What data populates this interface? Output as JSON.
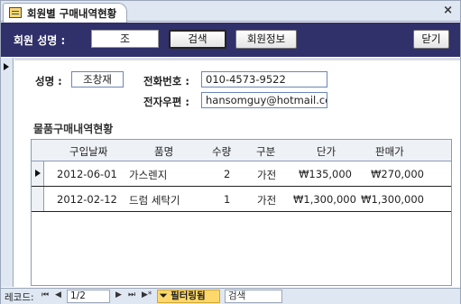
{
  "tab": {
    "title": "회원별 구매내역현황",
    "close": "×"
  },
  "header": {
    "member_name_label": "회원 성명 :",
    "member_name_value": "조",
    "search_button": "검색",
    "member_info_button": "회원정보",
    "close_button": "닫기"
  },
  "member": {
    "name_label": "성명 :",
    "name_value": "조창재",
    "phone_label": "전화번호 :",
    "phone_value": "010-4573-9522",
    "email_label": "전자우편 :",
    "email_value": "hansomguy@hotmail.co.kr"
  },
  "purchases": {
    "title": "물품구매내역현황",
    "columns": [
      "구입날짜",
      "품명",
      "수량",
      "구분",
      "단가",
      "판매가"
    ],
    "rows": [
      [
        "2012-06-01",
        "가스렌지",
        "2",
        "가전",
        "₩135,000",
        "₩270,000"
      ],
      [
        "2012-02-12",
        "드럼 세탁기",
        "1",
        "가전",
        "₩1,300,000",
        "₩1,300,000"
      ]
    ]
  },
  "navigation": {
    "label": "레코드:",
    "first": "⏮",
    "prev": "◀",
    "position": "1/2",
    "next": "▶",
    "last": "⏭",
    "new": "▶*",
    "filter": "필터링됨",
    "search_placeholder": "검색"
  }
}
